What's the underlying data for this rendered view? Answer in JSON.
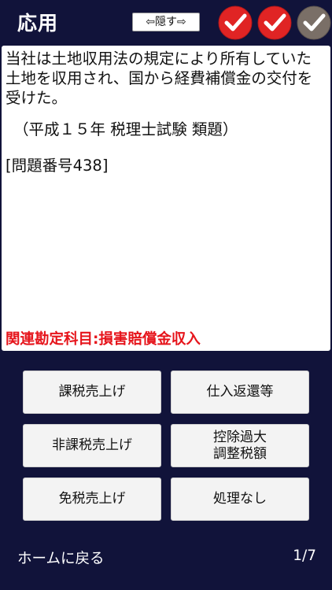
{
  "header": {
    "title": "応用",
    "hide_label": "⇦隠す⇨",
    "checks": [
      {
        "icon": "checkmark-circle-icon",
        "color": "#e02424",
        "state": "correct"
      },
      {
        "icon": "checkmark-circle-icon",
        "color": "#e02424",
        "state": "correct"
      },
      {
        "icon": "checkmark-circle-icon",
        "color": "#7a6f67",
        "state": "unanswered"
      }
    ]
  },
  "question": {
    "text": "当社は土地収用法の規定により所有していた土地を収用され、国から経費補償金の交付を受けた。",
    "source": "（平成１５年 税理士試験 類題）",
    "number": "[問題番号438]",
    "related": "関連勘定科目:損害賠償金収入"
  },
  "answers": [
    {
      "label": "課税売上げ"
    },
    {
      "label": "仕入返還等"
    },
    {
      "label": "非課税売上げ"
    },
    {
      "label": "控除過大\n調整税額"
    },
    {
      "label": "免税売上げ"
    },
    {
      "label": "処理なし"
    }
  ],
  "footer": {
    "home_label": "ホームに戻る",
    "page": "1/7"
  },
  "colors": {
    "background": "#11133a",
    "related_text": "#e6141b",
    "check_active": "#e02424",
    "check_inactive": "#7a6f67"
  }
}
